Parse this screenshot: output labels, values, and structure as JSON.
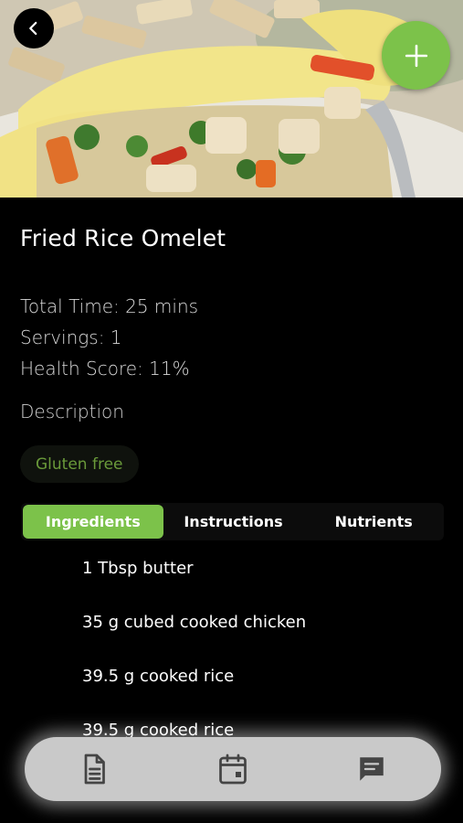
{
  "hero": {
    "image_alt": "Fried rice omelet photo"
  },
  "recipe": {
    "title": "Fried Rice Omelet",
    "total_time": "Total Time: 25 mins",
    "servings": "Servings: 1",
    "health_score": "Health Score: 11%",
    "description_label": "Description",
    "tags": [
      "Gluten free"
    ]
  },
  "tabs": [
    {
      "label": "Ingredients",
      "active": true
    },
    {
      "label": "Instructions",
      "active": false
    },
    {
      "label": "Nutrients",
      "active": false
    }
  ],
  "ingredients": [
    "1 Tbsp butter",
    "35 g cubed cooked chicken",
    "39.5 g cooked rice",
    "39.5 g cooked rice"
  ],
  "bottom_nav": {
    "items": [
      {
        "icon": "document-icon"
      },
      {
        "icon": "calendar-icon"
      },
      {
        "icon": "chat-icon"
      }
    ]
  },
  "colors": {
    "accent": "#7cc24a",
    "background": "#000000",
    "nav": "#c9c9c9",
    "tag_text": "#6a9a3a"
  }
}
